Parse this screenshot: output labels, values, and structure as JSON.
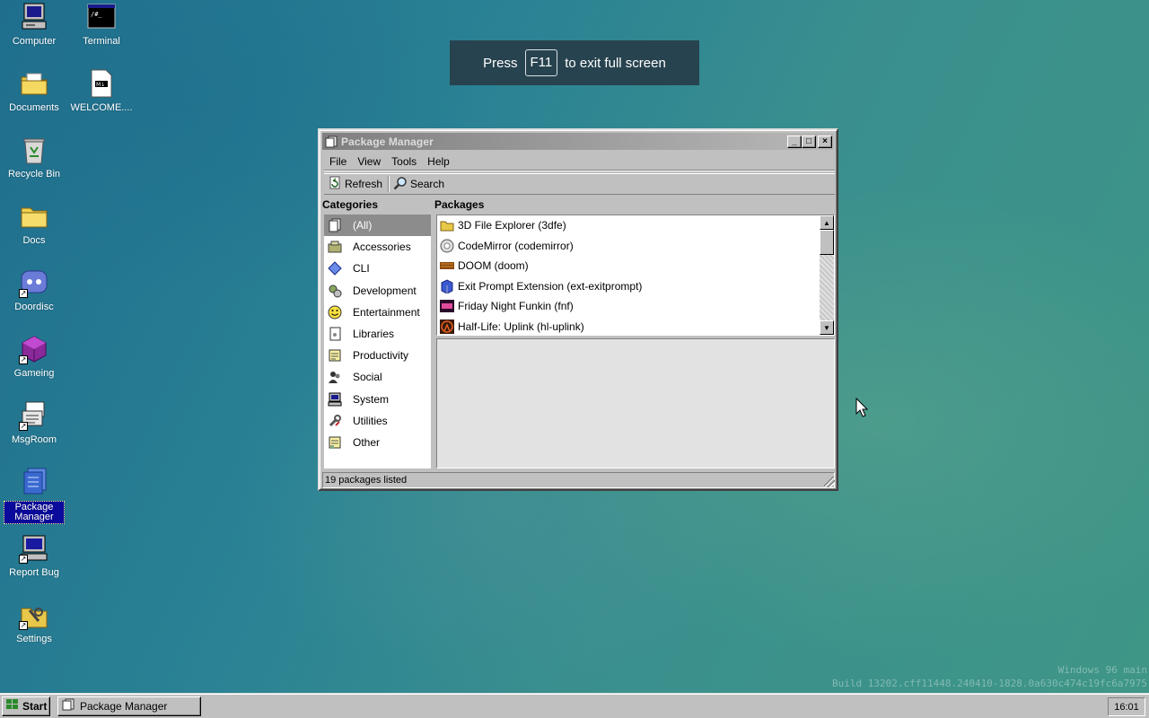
{
  "desktop": {
    "icons": [
      {
        "label": "Computer",
        "icon": "computer-icon"
      },
      {
        "label": "Terminal",
        "icon": "terminal-icon"
      },
      {
        "label": "Documents",
        "icon": "documents-folder-icon"
      },
      {
        "label": "WELCOME....",
        "icon": "markdown-file-icon"
      },
      {
        "label": "Recycle Bin",
        "icon": "recycle-bin-icon"
      },
      {
        "label": "Docs",
        "icon": "folder-icon"
      },
      {
        "label": "Doordisc",
        "icon": "doordisc-icon"
      },
      {
        "label": "Gameing",
        "icon": "gameing-icon"
      },
      {
        "label": "MsgRoom",
        "icon": "msgroom-icon"
      },
      {
        "label": "Package Manager",
        "icon": "package-manager-icon",
        "selected": true
      },
      {
        "label": "Report Bug",
        "icon": "report-bug-icon"
      },
      {
        "label": "Settings",
        "icon": "settings-icon"
      }
    ]
  },
  "fullscreen_notice": {
    "prefix": "Press",
    "key": "F11",
    "suffix": "to exit full screen"
  },
  "window": {
    "title": "Package Manager",
    "controls": {
      "minimize": "_",
      "maximize": "□",
      "close": "×"
    },
    "menu": [
      "File",
      "View",
      "Tools",
      "Help"
    ],
    "toolbar": {
      "refresh": "Refresh",
      "search": "Search"
    },
    "categories_header": "Categories",
    "packages_header": "Packages",
    "categories": [
      {
        "label": "(All)",
        "icon": "all-icon",
        "selected": true
      },
      {
        "label": "Accessories",
        "icon": "accessories-icon"
      },
      {
        "label": "CLI",
        "icon": "cli-icon"
      },
      {
        "label": "Development",
        "icon": "development-icon"
      },
      {
        "label": "Entertainment",
        "icon": "entertainment-icon"
      },
      {
        "label": "Libraries",
        "icon": "libraries-icon"
      },
      {
        "label": "Productivity",
        "icon": "productivity-icon"
      },
      {
        "label": "Social",
        "icon": "social-icon"
      },
      {
        "label": "System",
        "icon": "system-icon"
      },
      {
        "label": "Utilities",
        "icon": "utilities-icon"
      },
      {
        "label": "Other",
        "icon": "other-icon"
      }
    ],
    "packages": [
      {
        "label": "3D File Explorer (3dfe)",
        "icon": "folder-icon"
      },
      {
        "label": "CodeMirror (codemirror)",
        "icon": "codemirror-icon"
      },
      {
        "label": "DOOM (doom)",
        "icon": "doom-icon"
      },
      {
        "label": "Exit Prompt Extension (ext-exitprompt)",
        "icon": "extension-icon"
      },
      {
        "label": "Friday Night Funkin (fnf)",
        "icon": "fnf-icon"
      },
      {
        "label": "Half-Life: Uplink (hl-uplink)",
        "icon": "half-life-icon"
      }
    ],
    "status": "19 packages listed"
  },
  "taskbar": {
    "start_label": "Start",
    "tasks": [
      {
        "label": "Package Manager"
      }
    ],
    "clock": "16:01"
  },
  "watermark": {
    "line1": "Windows 96 main",
    "line2": "Build 13202.cff11448.240410-1828.0a630c474c19fc6a7975"
  }
}
